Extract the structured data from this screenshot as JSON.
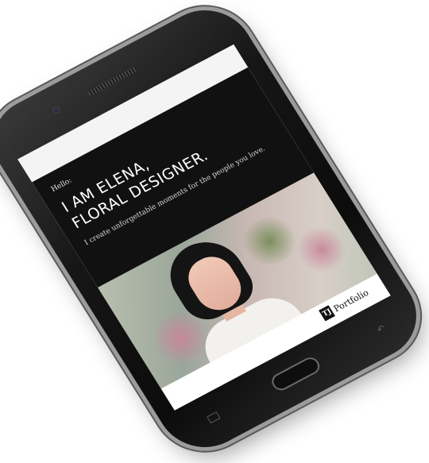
{
  "screen": {
    "greeting": "Hello:",
    "headline_line1": "I AM ELENA,",
    "headline_line2": "FLORAL DESIGNER.",
    "subtitle": "I create unforgettable moments for the people you love.",
    "footer_logo_mark": "TJ",
    "footer_logo_text": "Portfolio"
  },
  "colors": {
    "hero_bg": "#111111",
    "phone_body": "#161616",
    "topbar_bg": "#f4f4f4"
  },
  "icons": {
    "back_key": "back-arrow-icon",
    "menu_key": "menu-icon"
  }
}
